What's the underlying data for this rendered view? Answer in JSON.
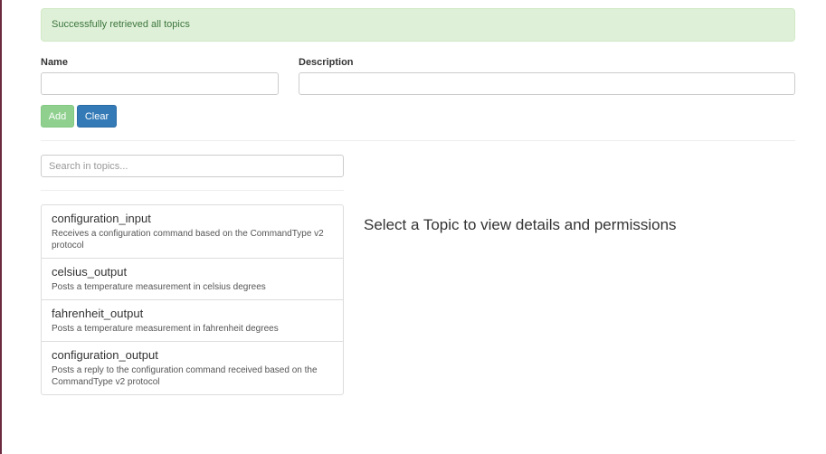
{
  "alert": {
    "message": "Successfully retrieved all topics"
  },
  "form": {
    "name_label": "Name",
    "description_label": "Description",
    "name_value": "",
    "description_value": "",
    "add_label": "Add",
    "clear_label": "Clear"
  },
  "search": {
    "placeholder": "Search in topics...",
    "value": ""
  },
  "topics": [
    {
      "name": "configuration_input",
      "description": "Receives a configuration command based on the CommandType v2 protocol"
    },
    {
      "name": "celsius_output",
      "description": "Posts a temperature measurement in celsius degrees"
    },
    {
      "name": "fahrenheit_output",
      "description": "Posts a temperature measurement in fahrenheit degrees"
    },
    {
      "name": "configuration_output",
      "description": "Posts a reply to the configuration command received based on the CommandType v2 protocol"
    }
  ],
  "details": {
    "empty_message": "Select a Topic to view details and permissions"
  },
  "colors": {
    "alert_bg": "#dff0d8",
    "alert_text": "#3c763d",
    "add_button": "#8fd08f",
    "clear_button": "#337ab7"
  }
}
